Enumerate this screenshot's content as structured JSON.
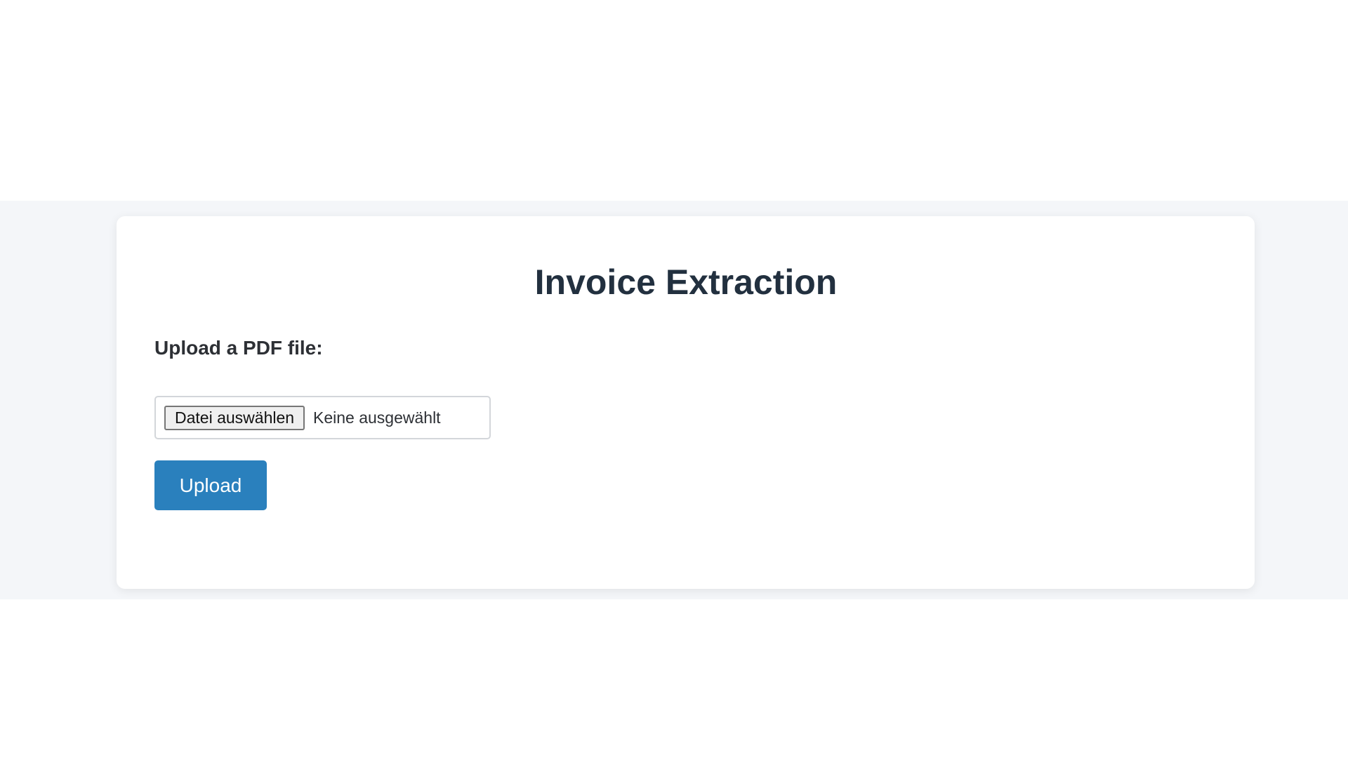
{
  "main": {
    "title": "Invoice Extraction",
    "upload_label": "Upload a PDF file:",
    "file_input": {
      "button_label": "Datei auswählen",
      "status_text": "Keine ausgewählt"
    },
    "upload_button_label": "Upload"
  },
  "colors": {
    "backdrop": "#f4f6f9",
    "card": "#ffffff",
    "title_text": "#22303f",
    "accent": "#2a80bd",
    "button_text": "#ffffff"
  }
}
